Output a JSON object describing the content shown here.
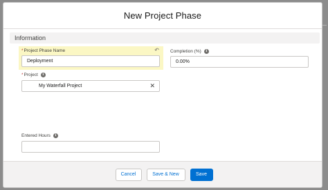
{
  "modal": {
    "title": "New Project Phase"
  },
  "section": {
    "label": "Information"
  },
  "fields": {
    "phase_name": {
      "label": "Project Phase Name",
      "required_mark": "*",
      "value": "Deployment"
    },
    "completion": {
      "label": "Completion (%)",
      "value": "0.00%"
    },
    "project": {
      "label": "Project",
      "required_mark": "*",
      "value": "My Waterfall Project",
      "clear_glyph": "✕"
    },
    "entered_hours": {
      "label": "Entered Hours",
      "value": ""
    }
  },
  "footer": {
    "cancel_label": "Cancel",
    "save_new_label": "Save & New",
    "save_label": "Save"
  },
  "icons": {
    "info": "info-icon",
    "undo": "undo-icon",
    "clear": "clear-icon"
  },
  "colors": {
    "brand": "#0070d2",
    "required": "#c23934",
    "highlight": "#fbf7c4"
  }
}
